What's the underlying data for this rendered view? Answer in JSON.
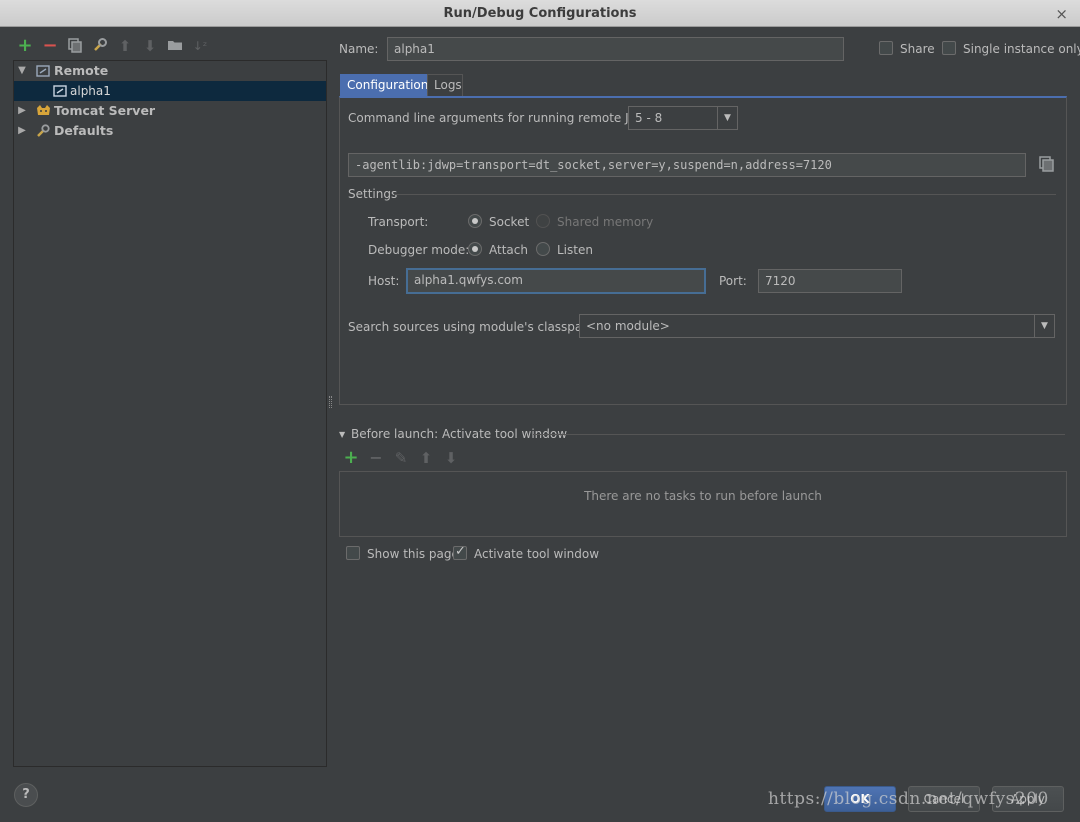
{
  "window": {
    "title": "Run/Debug Configurations",
    "close_glyph": "×"
  },
  "toolbar": {
    "icons": [
      "add-icon",
      "remove-icon",
      "copy-icon",
      "edit-defaults-icon",
      "move-up-icon",
      "move-down-icon",
      "folder-icon",
      "sort-icon"
    ]
  },
  "tree": {
    "items": [
      {
        "label": "Remote",
        "expanded": true,
        "icon": "remote-icon"
      },
      {
        "label": "alpha1",
        "selected": true,
        "icon": "remote-config-icon"
      },
      {
        "label": "Tomcat Server",
        "expanded": false,
        "icon": "tomcat-icon"
      },
      {
        "label": "Defaults",
        "expanded": false,
        "icon": "defaults-icon"
      }
    ]
  },
  "header": {
    "name_label": "Name:",
    "name_value": "alpha1",
    "share_label": "Share",
    "single_instance_label": "Single instance only"
  },
  "tabs": [
    {
      "label": "Configuration",
      "active": true
    },
    {
      "label": "Logs",
      "active": false
    }
  ],
  "config": {
    "jvm_label": "Command line arguments for running remote JVM",
    "jvm_version": "5 - 8",
    "jvm_args": "-agentlib:jdwp=transport=dt_socket,server=y,suspend=n,address=7120",
    "settings_label": "Settings",
    "transport_label": "Transport:",
    "transport_socket": "Socket",
    "transport_shared": "Shared memory",
    "debugger_mode_label": "Debugger mode:",
    "mode_attach": "Attach",
    "mode_listen": "Listen",
    "host_label": "Host:",
    "host_value": "alpha1.qwfys.com",
    "port_label": "Port:",
    "port_value": "7120",
    "module_label": "Search sources using module's classpath:",
    "module_value": "<no module>"
  },
  "before_launch": {
    "title": "Before launch: Activate tool window",
    "empty_text": "There are no tasks to run before launch",
    "show_page_label": "Show this page",
    "activate_label": "Activate tool window"
  },
  "buttons": {
    "ok": "OK",
    "cancel": "Cancel",
    "apply": "Apply",
    "help": "?"
  },
  "watermark": "https://blog.csdn.net/qwfys200"
}
